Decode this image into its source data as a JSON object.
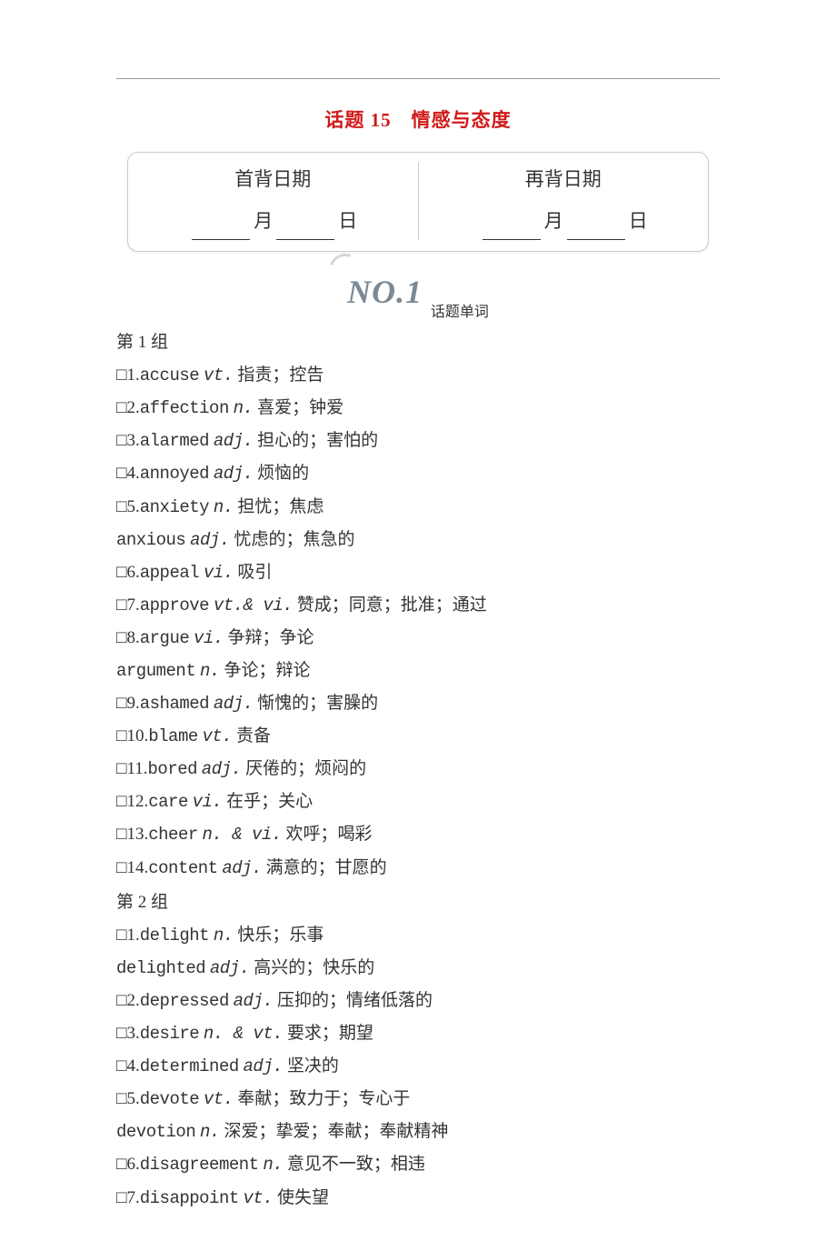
{
  "topic_title": "话题 15　情感与态度",
  "date_card": {
    "first_label": "首背日期",
    "again_label": "再背日期",
    "month_char": "月",
    "day_char": "日"
  },
  "section_no": "NO.1",
  "section_sub": "话题单词",
  "groups": [
    {
      "heading": "第 1 组",
      "entries": [
        {
          "n": "1",
          "word": "accuse",
          "pos": "vt.",
          "def": "指责；控告",
          "boxed": true
        },
        {
          "n": "2",
          "word": "affection",
          "pos": "n.",
          "def": "喜爱；钟爱",
          "boxed": true
        },
        {
          "n": "3",
          "word": "alarmed",
          "pos": "adj.",
          "def": "担心的；害怕的",
          "boxed": true
        },
        {
          "n": "4",
          "word": "annoyed",
          "pos": "adj.",
          "def": "烦恼的",
          "boxed": true
        },
        {
          "n": "5",
          "word": "anxiety",
          "pos": "n.",
          "def": "担忧；焦虑",
          "boxed": true
        },
        {
          "n": "",
          "word": "anxious",
          "pos": "adj.",
          "def": "忧虑的；焦急的",
          "boxed": false
        },
        {
          "n": "6",
          "word": "appeal",
          "pos": "vi.",
          "def": "吸引",
          "boxed": true
        },
        {
          "n": "7",
          "word": "approve",
          "pos": "vt.& vi.",
          "def": "赞成；同意；批准；通过",
          "boxed": true
        },
        {
          "n": "8",
          "word": "argue",
          "pos": "vi.",
          "def": "争辩；争论",
          "boxed": true
        },
        {
          "n": "",
          "word": "argument",
          "pos": "n.",
          "def": "争论；辩论",
          "boxed": false
        },
        {
          "n": "9",
          "word": "ashamed",
          "pos": "adj.",
          "def": "惭愧的；害臊的",
          "boxed": true
        },
        {
          "n": "10",
          "word": "blame",
          "pos": "vt.",
          "def": "责备",
          "boxed": true
        },
        {
          "n": "11",
          "word": "bored",
          "pos": "adj.",
          "def": "厌倦的；烦闷的",
          "boxed": true
        },
        {
          "n": "12",
          "word": "care",
          "pos": "vi.",
          "def": "在乎；关心",
          "boxed": true
        },
        {
          "n": "13",
          "word": "cheer",
          "pos": "n. & vi.",
          "def": "欢呼；喝彩",
          "boxed": true
        },
        {
          "n": "14",
          "word": "content",
          "pos": "adj.",
          "def": "满意的；甘愿的",
          "boxed": true
        }
      ]
    },
    {
      "heading": "第 2 组",
      "entries": [
        {
          "n": "1",
          "word": "delight",
          "pos": "n.",
          "def": "快乐；乐事",
          "boxed": true
        },
        {
          "n": "",
          "word": "delighted",
          "pos": "adj.",
          "def": "高兴的；快乐的",
          "boxed": false
        },
        {
          "n": "2",
          "word": "depressed",
          "pos": "adj.",
          "def": "压抑的；情绪低落的",
          "boxed": true
        },
        {
          "n": "3",
          "word": "desire",
          "pos": "n. & vt.",
          "def": "要求；期望",
          "boxed": true
        },
        {
          "n": "4",
          "word": "determined",
          "pos": "adj.",
          "def": "坚决的",
          "boxed": true
        },
        {
          "n": "5",
          "word": "devote",
          "pos": "vt.",
          "def": "奉献；致力于；专心于",
          "boxed": true
        },
        {
          "n": "",
          "word": "devotion",
          "pos": "n.",
          "def": "深爱；挚爱；奉献；奉献精神",
          "boxed": false
        },
        {
          "n": "6",
          "word": "disagreement",
          "pos": "n.",
          "def": "意见不一致；相违",
          "boxed": true
        },
        {
          "n": "7",
          "word": "disappoint",
          "pos": "vt.",
          "def": "使失望",
          "boxed": true
        }
      ]
    }
  ]
}
